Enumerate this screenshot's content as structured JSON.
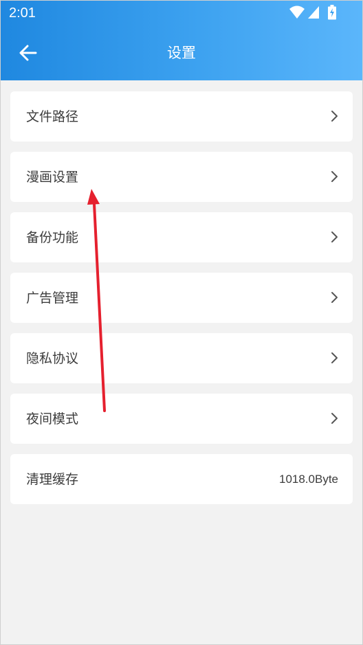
{
  "status_bar": {
    "time": "2:01",
    "icons": [
      "wifi-icon",
      "cell-signal-icon",
      "battery-charging-icon"
    ]
  },
  "header": {
    "title": "设置",
    "back_icon": "arrow-left-icon"
  },
  "settings": {
    "items": [
      {
        "label": "文件路径",
        "icon": "chevron-right-icon"
      },
      {
        "label": "漫画设置",
        "icon": "chevron-right-icon"
      },
      {
        "label": "备份功能",
        "icon": "chevron-right-icon"
      },
      {
        "label": "广告管理",
        "icon": "chevron-right-icon"
      },
      {
        "label": "隐私协议",
        "icon": "chevron-right-icon"
      },
      {
        "label": "夜间模式",
        "icon": "chevron-right-icon"
      },
      {
        "label": "清理缓存",
        "value": "1018.0Byte"
      }
    ]
  },
  "colors": {
    "header_gradient_start": "#1f88e0",
    "header_gradient_end": "#5bb6fb",
    "background": "#f2f2f2",
    "card": "#ffffff",
    "text": "#3c3c3c",
    "annotation_arrow": "#e5202e"
  }
}
